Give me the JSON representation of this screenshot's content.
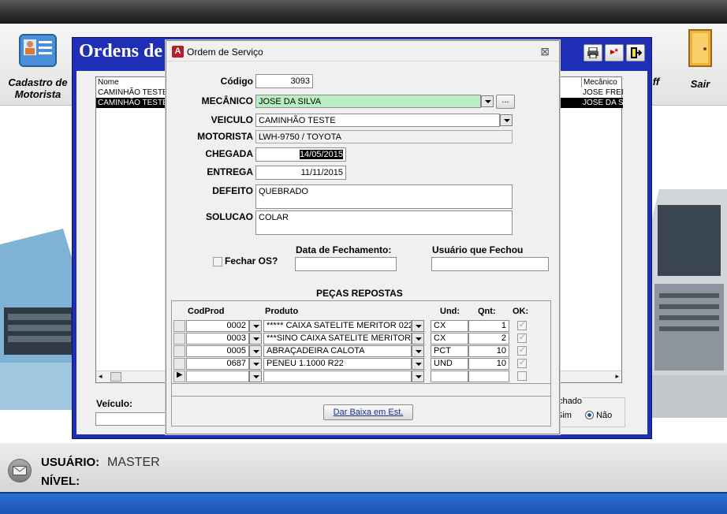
{
  "toolbar": {
    "cadastro_label_1": "Cadastro de",
    "cadastro_label_2": "Motorista",
    "off_label": "ff",
    "sair_label": "Sair"
  },
  "main_window": {
    "title": "Ordens de",
    "grid": {
      "col_nome": "Nome",
      "col_mecanico": "Mecânico",
      "rows": [
        {
          "nome": "CAMINHÃO TESTE",
          "mecanico": "JOSE FREI"
        },
        {
          "nome": "CAMINHÃO TESTE",
          "mecanico": "JOSE DA S"
        }
      ]
    },
    "veiculo_label": "Veículo:",
    "fechado_label": "chado",
    "radio_sim": "Sim",
    "radio_nao": "Não"
  },
  "dialog": {
    "title": "Ordem de Serviço",
    "codigo_label": "Código",
    "codigo_value": "3093",
    "mecanico_label": "MECÂNICO",
    "mecanico_value": "JOSE DA SILVA",
    "mecanico_more": "...",
    "veiculo_label": "VEICULO",
    "veiculo_value": "CAMINHÃO TESTE",
    "motorista_label": "MOTORISTA",
    "motorista_value": "LWH-9750 / TOYOTA",
    "chegada_label": "CHEGADA",
    "chegada_value": "14/05/2015",
    "entrega_label": "ENTREGA",
    "entrega_value": "11/11/2015",
    "defeito_label": "DEFEITO",
    "defeito_value": "QUEBRADO",
    "solucao_label": "SOLUCAO",
    "solucao_value": "COLAR",
    "fechar_os_label": "Fechar OS?",
    "data_fechamento_label": "Data de Fechamento:",
    "usuario_fechou_label": "Usuário que Fechou",
    "pecas_title": "PEÇAS REPOSTAS",
    "pecas": {
      "headers": {
        "codprod": "CodProd",
        "produto": "Produto",
        "und": "Und:",
        "qnt": "Qnt:",
        "ok": "OK:"
      },
      "rows": [
        {
          "codprod": "0002",
          "produto": "***** CAIXA SATELITE MERITOR 022",
          "und": "CX",
          "qnt": "1",
          "ok": true
        },
        {
          "codprod": "0003",
          "produto": "***SINO CAIXA SATELITE MERITOR",
          "und": "CX",
          "qnt": "2",
          "ok": true
        },
        {
          "codprod": "0005",
          "produto": "ABRAÇADEIRA CALOTA",
          "und": "PCT",
          "qnt": "10",
          "ok": true
        },
        {
          "codprod": "0687",
          "produto": "PENEU 1.1000 R22",
          "und": "UND",
          "qnt": "10",
          "ok": true
        }
      ]
    },
    "dar_baixa_label": "Dar Baixa em Est."
  },
  "status": {
    "usuario_label": "USUÁRIO:",
    "usuario_value": "MASTER",
    "nivel_label": "NÍVEL:"
  },
  "colors": {
    "window_blue": "#1e2fb5",
    "mecanico_field": "#b9eec2",
    "bottom_bar": "#2d6fd2"
  }
}
